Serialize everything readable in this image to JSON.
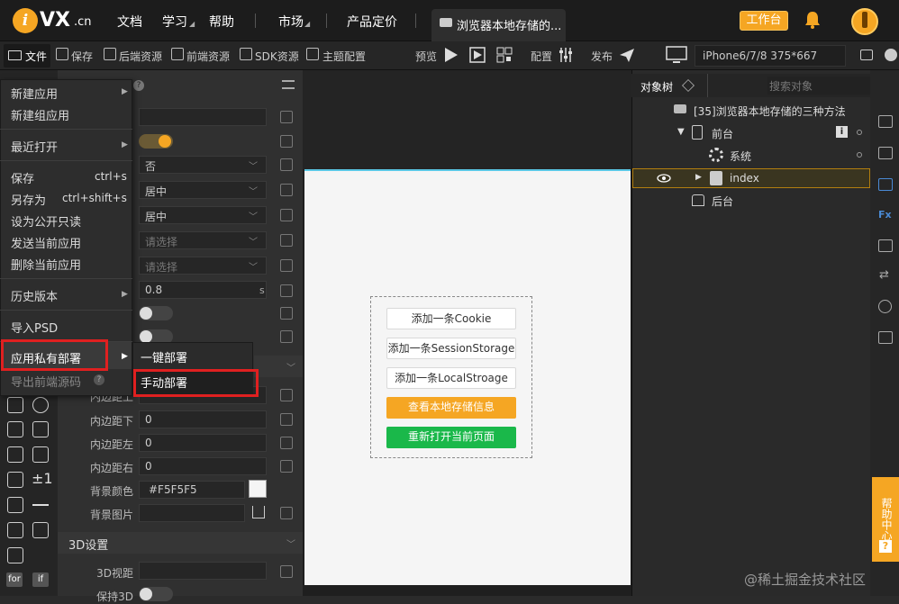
{
  "topnav": {
    "logo_v": "i",
    "logo_text": "VX",
    "logo_cn": ".cn",
    "items": [
      "文档",
      "学习",
      "帮助",
      "市场",
      "产品定价"
    ],
    "doc_tab": "浏览器本地存储的...",
    "workbench": "工作台"
  },
  "toolbar": {
    "file": "文件",
    "save": "保存",
    "backend": "后端资源",
    "frontend": "前端资源",
    "sdk": "SDK资源",
    "theme": "主题配置",
    "preview": "预览",
    "config": "配置",
    "publish": "发布",
    "device": "iPhone6/7/8 375*667"
  },
  "file_menu": {
    "items": [
      {
        "label": "新建应用",
        "arrow": true
      },
      {
        "label": "新建组应用",
        "arrow": false
      },
      {
        "label": "最近打开",
        "arrow": true
      },
      {
        "label": "保存",
        "shortcut": "ctrl+s"
      },
      {
        "label": "另存为",
        "shortcut": "ctrl+shift+s"
      },
      {
        "label": "设为公开只读"
      },
      {
        "label": "发送当前应用"
      },
      {
        "label": "删除当前应用"
      },
      {
        "label": "历史版本",
        "arrow": true
      },
      {
        "label": "导入PSD"
      },
      {
        "label": "应用私有部署",
        "arrow": true
      },
      {
        "label": "导出前端源码"
      }
    ],
    "submenu": [
      "一键部署",
      "手动部署"
    ]
  },
  "props": {
    "select_no": "否",
    "select_center1": "居中",
    "select_center2": "居中",
    "select_placeholder1": "请选择",
    "select_placeholder2": "请选择",
    "duration": "0.8",
    "duration_unit": "s",
    "padding_label_top": "内边距上",
    "padding_label_bottom": "内边距下",
    "padding_label_left": "内边距左",
    "padding_label_right": "内边距右",
    "padding_bottom": "0",
    "padding_left": "0",
    "padding_right": "0",
    "bg_color_label": "背景颜色",
    "bg_color": "#F5F5F5",
    "bg_image_label": "背景图片",
    "section_3d": "3D设置",
    "view_3d_label": "3D视距",
    "keep_3d_label": "保持3D"
  },
  "canvas": {
    "buttons": [
      "添加一条Cookie",
      "添加一条SessionStorage",
      "添加一条LocalStroage",
      "查看本地存储信息",
      "重新打开当前页面"
    ]
  },
  "tree": {
    "header": "对象树",
    "search_placeholder": "搜索对象",
    "app": "[35]浏览器本地存储的三种方法",
    "frontend": "前台",
    "system": "系统",
    "index": "index",
    "backend": "后台"
  },
  "help": "帮助中心",
  "watermark": "@稀土掘金技术社区",
  "colors": {
    "accent": "#f5a623",
    "green": "#1ab84a",
    "highlight": "#e02020"
  }
}
